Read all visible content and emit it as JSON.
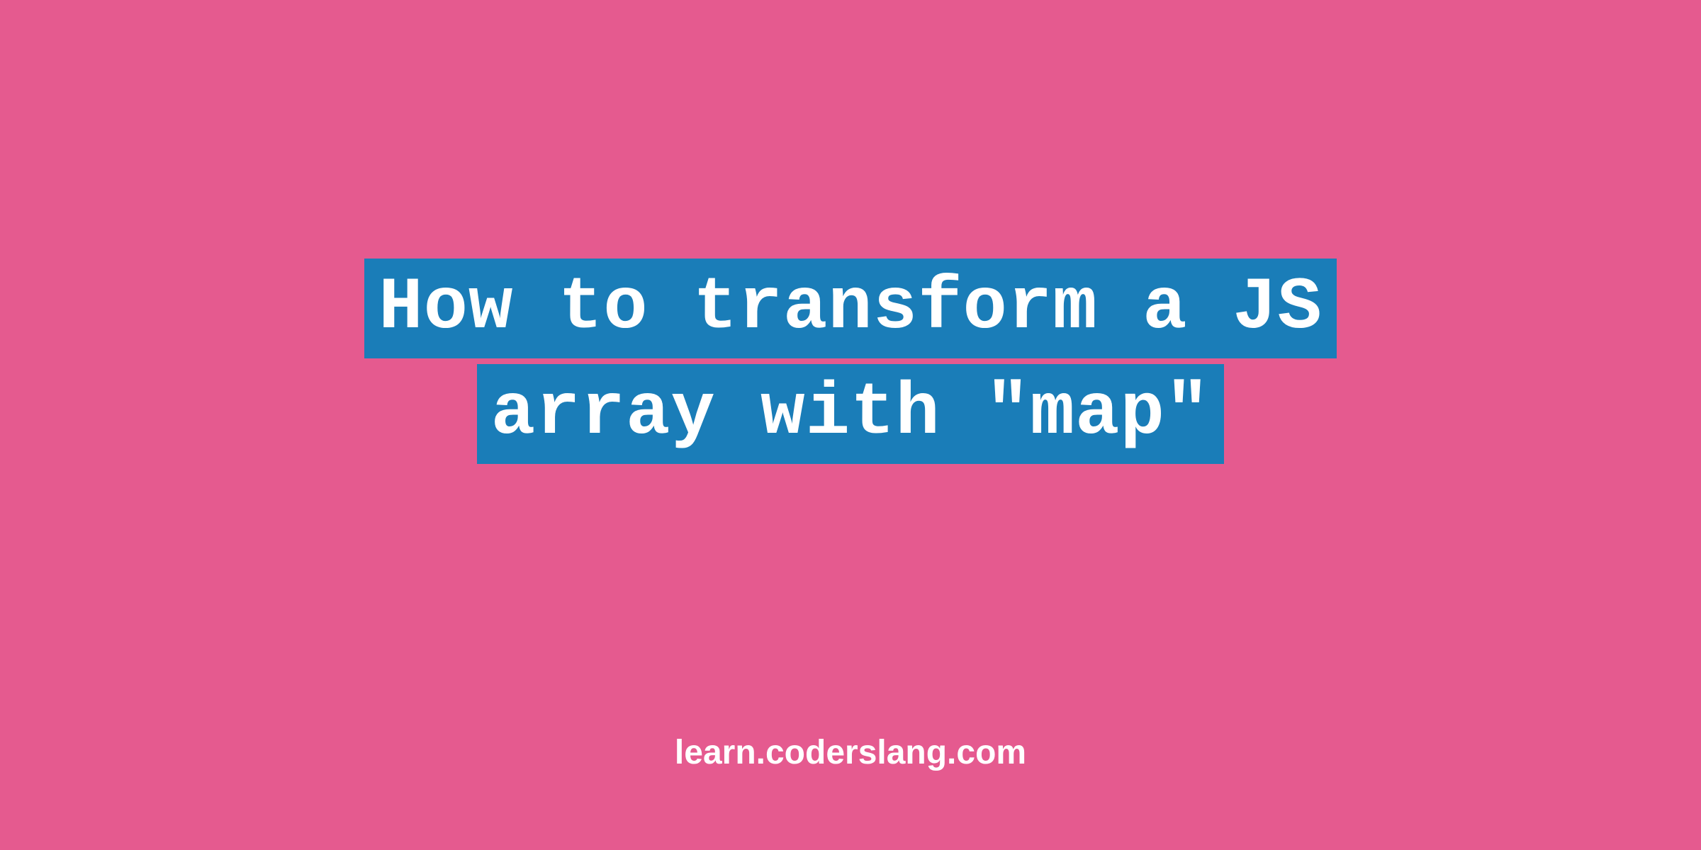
{
  "title": {
    "line1": "How to transform a JS",
    "line2": "array with \"map\""
  },
  "footer": {
    "url": "learn.coderslang.com"
  },
  "colors": {
    "background": "#e55a8f",
    "highlight": "#1a7db8",
    "text": "#ffffff"
  }
}
